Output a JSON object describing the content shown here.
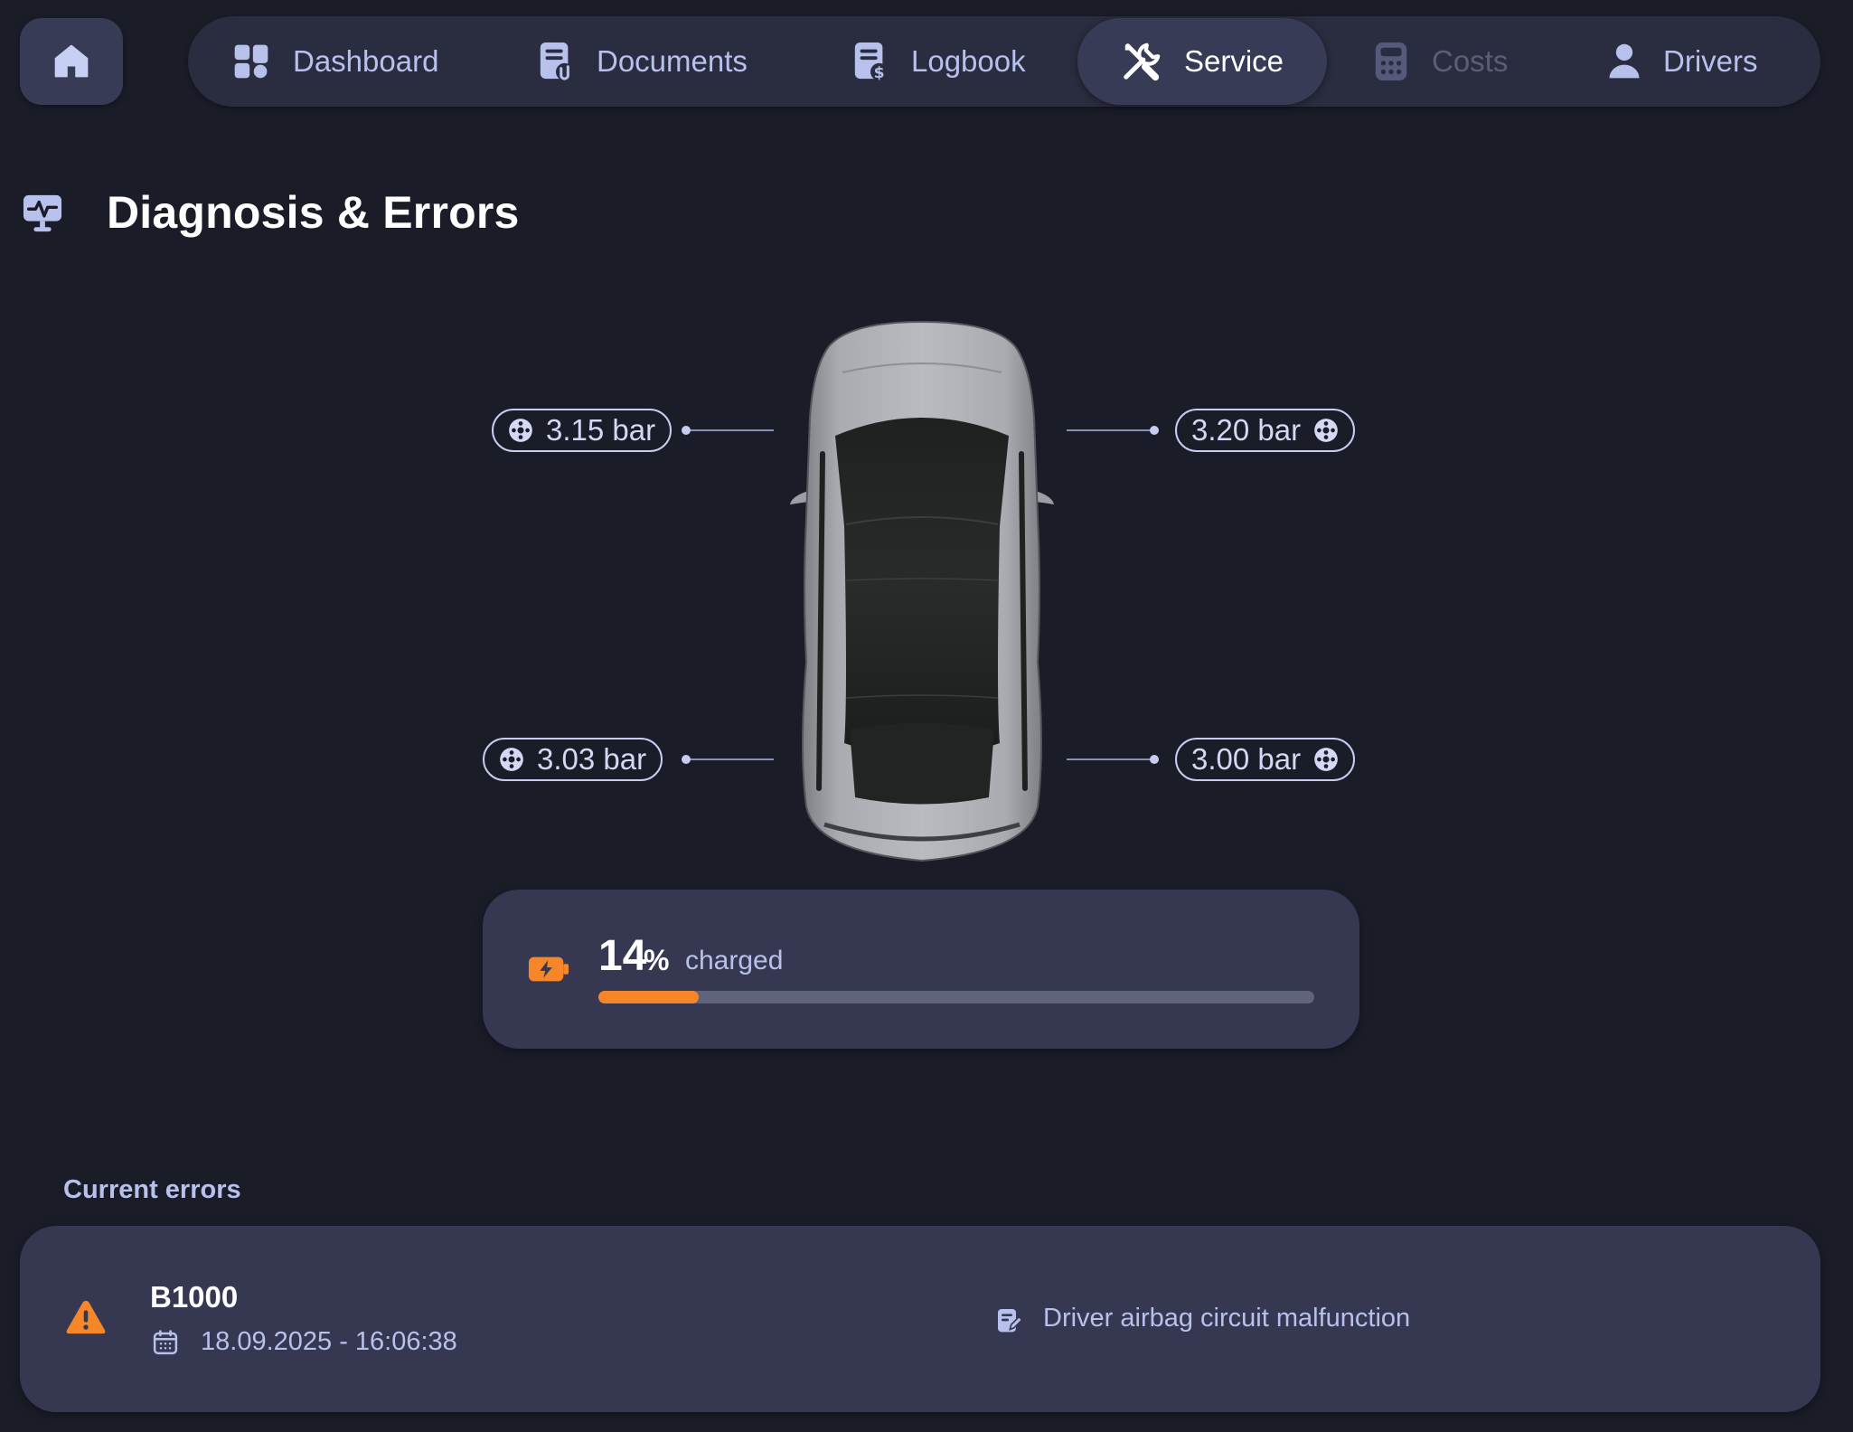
{
  "nav": {
    "items": [
      {
        "label": "Dashboard",
        "icon": "dashboard-icon",
        "state": "normal"
      },
      {
        "label": "Documents",
        "icon": "documents-icon",
        "state": "normal"
      },
      {
        "label": "Logbook",
        "icon": "logbook-icon",
        "state": "normal"
      },
      {
        "label": "Service",
        "icon": "service-icon",
        "state": "active"
      },
      {
        "label": "Costs",
        "icon": "costs-icon",
        "state": "disabled"
      },
      {
        "label": "Drivers",
        "icon": "drivers-icon",
        "state": "normal"
      }
    ]
  },
  "section": {
    "title": "Diagnosis & Errors"
  },
  "tires": {
    "front_left": "3.15 bar",
    "front_right": "3.20 bar",
    "rear_left": "3.03 bar",
    "rear_right": "3.00 bar"
  },
  "battery": {
    "percent": 14,
    "percent_text": "14",
    "percent_sign": "%",
    "label": "charged"
  },
  "errors": {
    "heading": "Current errors",
    "items": [
      {
        "code": "B1000",
        "datetime": "18.09.2025 - 16:06:38",
        "description": "Driver airbag circuit malfunction"
      }
    ]
  },
  "colors": {
    "background": "#1a1c28",
    "card": "#353850",
    "nav": "#2a2c3f",
    "accent_text": "#b8c0ec",
    "battery_fill": "#f5862a",
    "warning": "#f5862a"
  }
}
